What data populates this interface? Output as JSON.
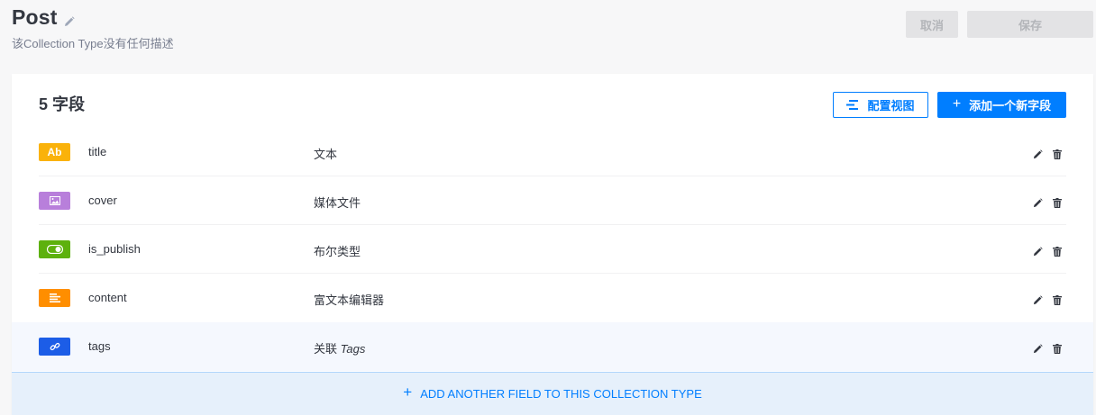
{
  "header": {
    "title": "Post",
    "subtitle": "该Collection Type没有任何描述",
    "cancel_label": "取消",
    "save_label": "保存"
  },
  "card": {
    "field_count": "5 字段",
    "configure_view_label": "配置视图",
    "add_field_label": "添加一个新字段",
    "footer_label": "ADD ANOTHER FIELD TO THIS COLLECTION TYPE",
    "plus_glyph": "+"
  },
  "fields": [
    {
      "name": "title",
      "type": "文本",
      "icon": "text-icon",
      "badge_text": "Ab",
      "color": "#fab20a"
    },
    {
      "name": "cover",
      "type": "媒体文件",
      "icon": "media-icon",
      "badge_text": "",
      "color": "#b87fdb"
    },
    {
      "name": "is_publish",
      "type": "布尔类型",
      "icon": "boolean-icon",
      "badge_text": "",
      "color": "#5db10d"
    },
    {
      "name": "content",
      "type": "富文本编辑器",
      "icon": "richtext-icon",
      "badge_text": "",
      "color": "#ff8e00"
    },
    {
      "name": "tags",
      "type": "关联",
      "type_target": "Tags",
      "icon": "relation-icon",
      "badge_text": "",
      "color": "#1c5de7"
    }
  ],
  "colors": {
    "primary": "#007eff",
    "disabled_bg": "#e3e3e5",
    "footer_bg": "#e6f0fb"
  }
}
